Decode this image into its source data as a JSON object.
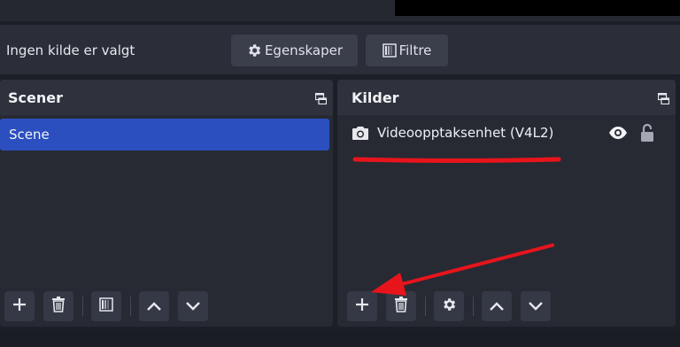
{
  "context_bar": {
    "no_source_label": "Ingen kilde er valgt",
    "properties_label": "Egenskaper",
    "filters_label": "Filtre"
  },
  "scenes": {
    "title": "Scener",
    "items": [
      {
        "label": "Scene",
        "selected": true
      }
    ]
  },
  "sources": {
    "title": "Kilder",
    "items": [
      {
        "label": "Videoopptaksenhet (V4L2)",
        "icon": "camera-icon",
        "visible": true,
        "locked": false
      }
    ]
  },
  "toolbar_icons": [
    "plus-icon",
    "trash-icon",
    "filter-icon",
    "gear-icon",
    "chevron-up-icon",
    "chevron-down-icon"
  ],
  "colors": {
    "background": "#1d1f27",
    "panel": "#272a33",
    "selection": "#2c4fbf",
    "button": "#3b3e4b",
    "annotation": "#e8141c"
  }
}
